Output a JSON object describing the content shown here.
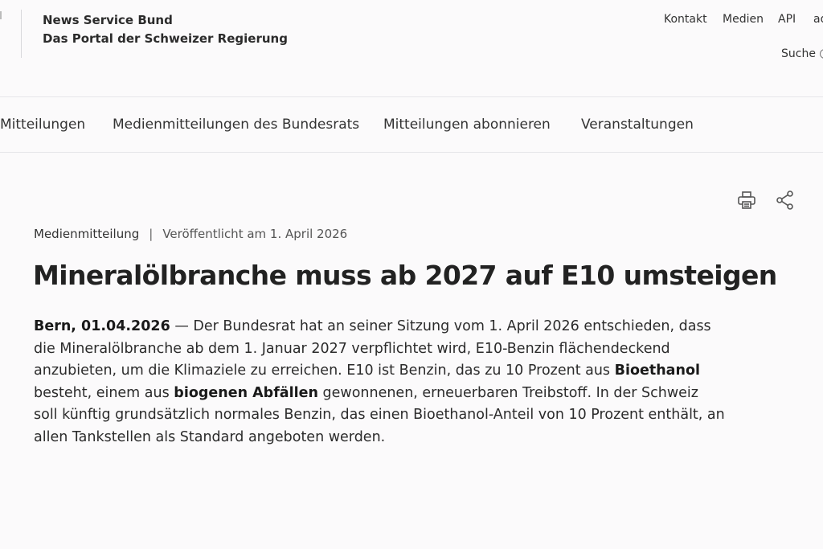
{
  "header": {
    "title_line1": "News Service Bund",
    "title_line2": "Das Portal der Schweizer Regierung",
    "meta_nav": [
      "Kontakt",
      "Medien",
      "API",
      "ad"
    ],
    "search_label": "Suche"
  },
  "main_nav": [
    "Mitteilungen",
    "Medienmitteilungen des Bundesrats",
    "Mitteilungen abonnieren",
    "Veranstaltungen"
  ],
  "tools": {
    "print": "printer-icon",
    "share": "share-icon"
  },
  "article": {
    "type": "Medienmitteilung",
    "separator": "|",
    "published": "Veröffentlicht am 1. April 2026",
    "headline": "Mineralölbranche muss ab 2027 auf E10 umsteigen",
    "dateline": "Bern, 01.04.2026",
    "text_1": " — Der Bundesrat hat an seiner Sitzung vom 1. April 2026 entschieden, dass die Mineralölbranche ab dem 1. Januar 2027 verpflichtet wird, E10-Benzin flächendeckend anzubieten, um die Klimaziele zu erreichen. E10 ist Benzin, das zu 10 Prozent aus ",
    "bold_1": "Bioethanol",
    "text_2": " besteht, einem aus ",
    "bold_2": "biogenen Abfällen",
    "text_3": " gewonnenen, erneuerbaren Treibstoff. In der Schweiz soll künftig grundsätzlich normales Benzin, das einen Bioethanol-Anteil von 10 Prozent enthält, an allen Tankstellen als Standard angeboten werden."
  }
}
